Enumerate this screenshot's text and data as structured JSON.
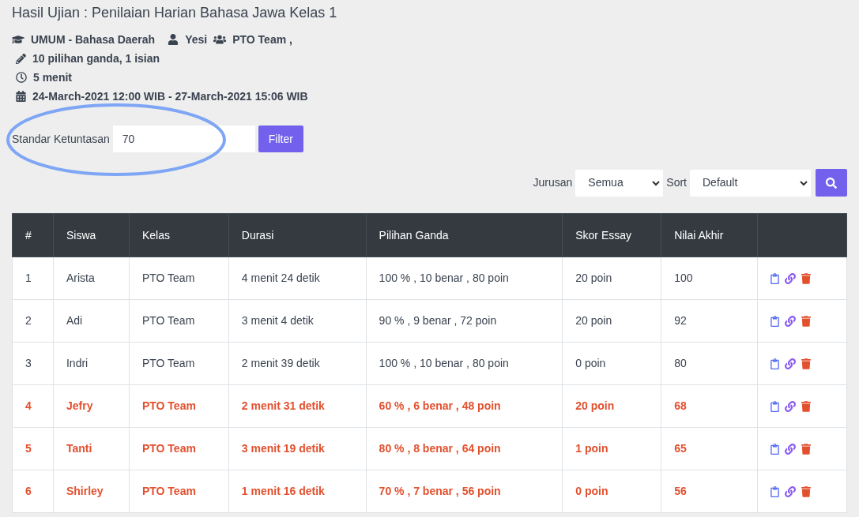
{
  "title": "Hasil Ujian : Penilaian Harian Bahasa Jawa Kelas 1",
  "meta": {
    "subject": "UMUM - Bahasa Daerah",
    "teacher": "Yesi",
    "group": "PTO Team ,",
    "questions": "10 pilihan ganda, 1 isian",
    "duration": "5 menit",
    "period": "24-March-2021 12:00 WIB - 27-March-2021 15:06 WIB"
  },
  "filter": {
    "label": "Standar Ketuntasan",
    "value": "70",
    "button": "Filter",
    "highlighted": true
  },
  "toolbar": {
    "jurusan_label": "Jurusan",
    "jurusan_value": "Semua",
    "sort_label": "Sort",
    "sort_value": "Default"
  },
  "table": {
    "columns": [
      "#",
      "Siswa",
      "Kelas",
      "Durasi",
      "Pilihan Ganda",
      "Skor Essay",
      "Nilai Akhir"
    ],
    "rows": [
      {
        "no": "1",
        "name": "Arista",
        "class": "PTO Team",
        "duration": "4 menit 24 detik",
        "choice": "100 % , 10 benar , 80 poin",
        "essay": "20 poin",
        "final": "100",
        "passed": true
      },
      {
        "no": "2",
        "name": "Adi",
        "class": "PTO Team",
        "duration": "3 menit 4 detik",
        "choice": "90 % , 9 benar , 72 poin",
        "essay": "20 poin",
        "final": "92",
        "passed": true
      },
      {
        "no": "3",
        "name": "Indri",
        "class": "PTO Team",
        "duration": "2 menit 39 detik",
        "choice": "100 % , 10 benar , 80 poin",
        "essay": "0 poin",
        "final": "80",
        "passed": true
      },
      {
        "no": "4",
        "name": "Jefry",
        "class": "PTO Team",
        "duration": "2 menit 31 detik",
        "choice": "60 % , 6 benar , 48 poin",
        "essay": "20 poin",
        "final": "68",
        "passed": false
      },
      {
        "no": "5",
        "name": "Tanti",
        "class": "PTO Team",
        "duration": "3 menit 19 detik",
        "choice": "80 % , 8 benar , 64 poin",
        "essay": "1 poin",
        "final": "65",
        "passed": false
      },
      {
        "no": "6",
        "name": "Shirley",
        "class": "PTO Team",
        "duration": "1 menit 16 detik",
        "choice": "70 % , 7 benar , 56 poin",
        "essay": "0 poin",
        "final": "56",
        "passed": false
      }
    ]
  }
}
